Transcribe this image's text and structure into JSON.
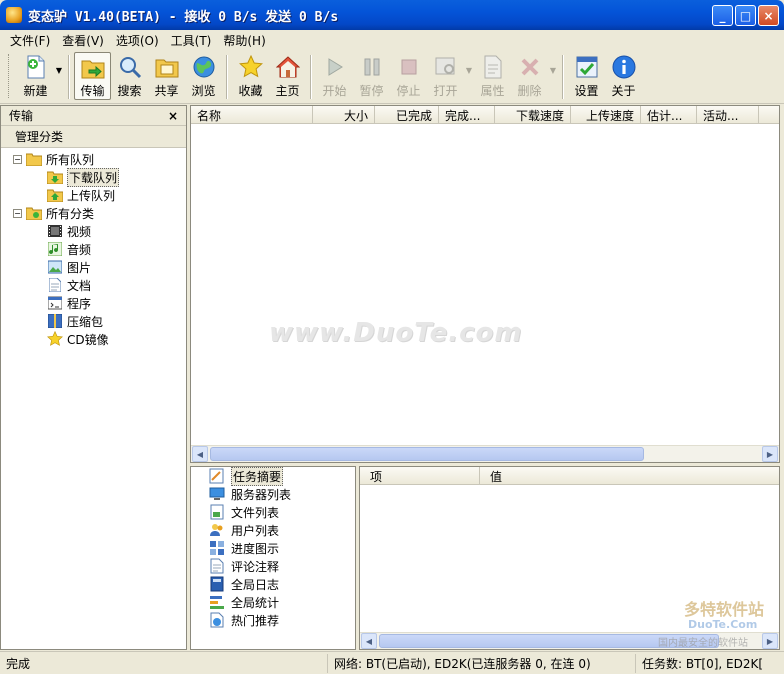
{
  "window": {
    "title": "变态驴 V1.40(BETA) - 接收 0 B/s 发送 0 B/s",
    "buttons": [
      "_",
      "□",
      "×"
    ]
  },
  "menu": [
    "文件(F)",
    "查看(V)",
    "选项(O)",
    "工具(T)",
    "帮助(H)"
  ],
  "toolbar": {
    "new": "新建",
    "transfer": "传输",
    "search": "搜索",
    "share": "共享",
    "browse": "浏览",
    "favorites": "收藏",
    "home": "主页",
    "start": "开始",
    "pause": "暂停",
    "stop": "停止",
    "open": "打开",
    "properties": "属性",
    "delete": "删除",
    "settings": "设置",
    "about": "关于"
  },
  "left_pane": {
    "header": "传输",
    "close": "×",
    "subheader": "管理分类",
    "tree": {
      "all_queues": "所有队列",
      "download_queue": "下载队列",
      "upload_queue": "上传队列",
      "all_categories": "所有分类",
      "video": "视频",
      "audio": "音频",
      "images": "图片",
      "documents": "文档",
      "programs": "程序",
      "archives": "压缩包",
      "cd_image": "CD镜像"
    }
  },
  "transfer_list": {
    "columns": [
      "名称",
      "大小",
      "已完成",
      "完成...",
      "下载速度",
      "上传速度",
      "估计...",
      "活动..."
    ],
    "rows": []
  },
  "info_list": {
    "items": [
      "任务摘要",
      "服务器列表",
      "文件列表",
      "用户列表",
      "进度图示",
      "评论注释",
      "全局日志",
      "全局统计",
      "热门推荐"
    ],
    "selected": "任务摘要"
  },
  "detail_table": {
    "columns": [
      "项",
      "值"
    ]
  },
  "watermark": "www.DuoTe.com",
  "brandmark": {
    "line1": "多特软件站",
    "line2": "DuoTe.Com",
    "line3": "国内最安全的软件站"
  },
  "statusbar": {
    "state": "完成",
    "network": "网络: BT(已启动), ED2K(已连服务器 0, 在连 0)",
    "tasks": "任务数: BT[0], ED2K["
  },
  "colors": {
    "titlebar": "#0454d8",
    "chrome": "#ece9d8",
    "pane_bg": "#ffffff"
  }
}
